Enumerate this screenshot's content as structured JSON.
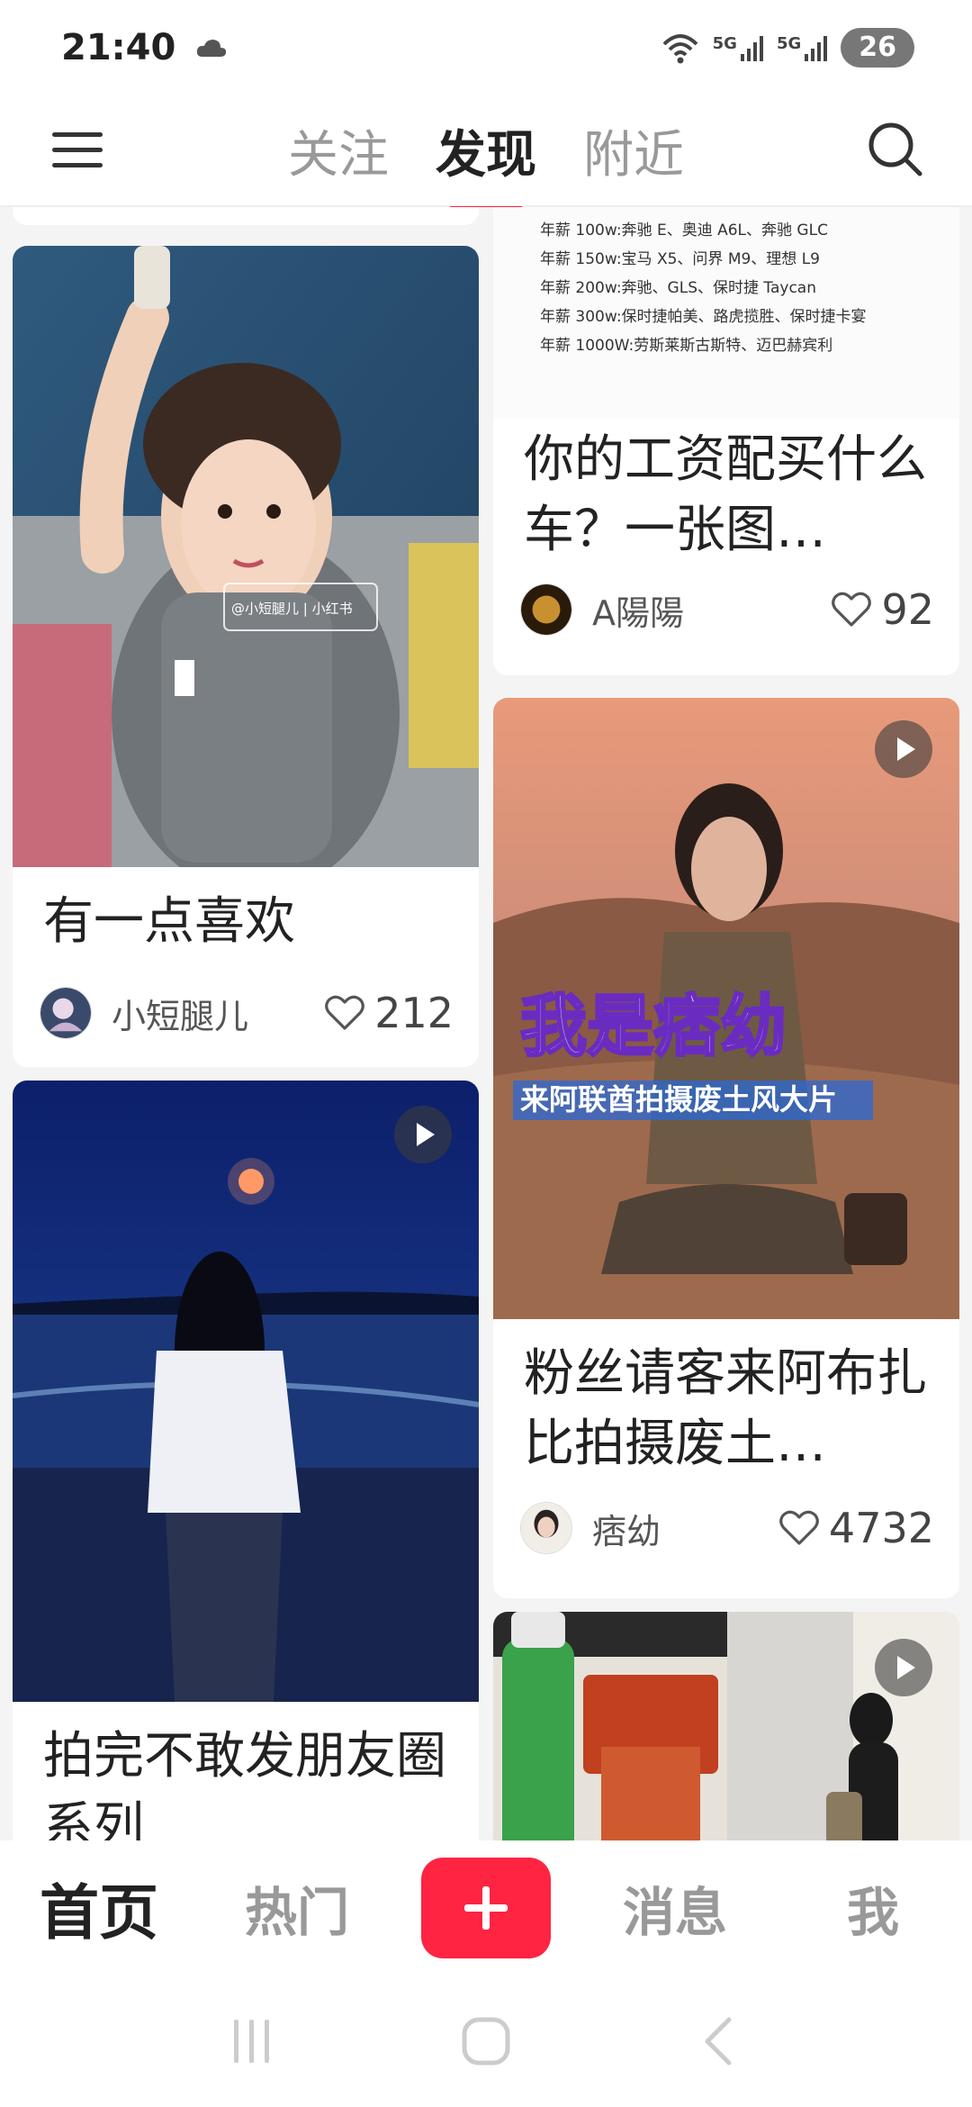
{
  "status_bar": {
    "time": "21:40",
    "signal_1": "5G",
    "signal_2": "5G",
    "battery": "26"
  },
  "top_nav": {
    "tabs": [
      {
        "label": "关注",
        "active": false
      },
      {
        "label": "发现",
        "active": true
      },
      {
        "label": "附近",
        "active": false
      }
    ]
  },
  "feed": {
    "cards": [
      {
        "title": "有一点喜欢",
        "author": "小短腿儿",
        "likes": "212",
        "image_watermark": "@小短腿儿 | 小红书",
        "video": false
      },
      {
        "title": "你的工资配买什么车？一张图…",
        "author": "A陽陽",
        "likes": "92",
        "video": false,
        "image_text_lines": [
          "年薪  100w:奔驰 E、奥迪 A6L、奔驰 GLC",
          "年薪  150w:宝马 X5、问界 M9、理想 L9",
          "年薪  200w:奔驰、GLS、保时捷 Taycan",
          "年薪  300w:保时捷帕美、路虎揽胜、保时捷卡宴",
          "年薪  1000W:劳斯莱斯古斯特、迈巴赫宾利"
        ]
      },
      {
        "title": "粉丝请客来阿布扎比拍摄废土…",
        "author": "痞幼",
        "likes": "4732",
        "video": true,
        "overlay_title": "我是痞幼",
        "overlay_subtitle": "来阿联酋拍摄废土风大片"
      },
      {
        "title": "拍完不敢发朋友圈系列",
        "video": true
      },
      {
        "video": true
      }
    ]
  },
  "bottom_nav": {
    "items": [
      "首页",
      "热门",
      "消息",
      "我"
    ],
    "active": "首页"
  },
  "colors": {
    "accent": "#ff2442",
    "text_primary": "#222222",
    "text_secondary": "#999999"
  }
}
